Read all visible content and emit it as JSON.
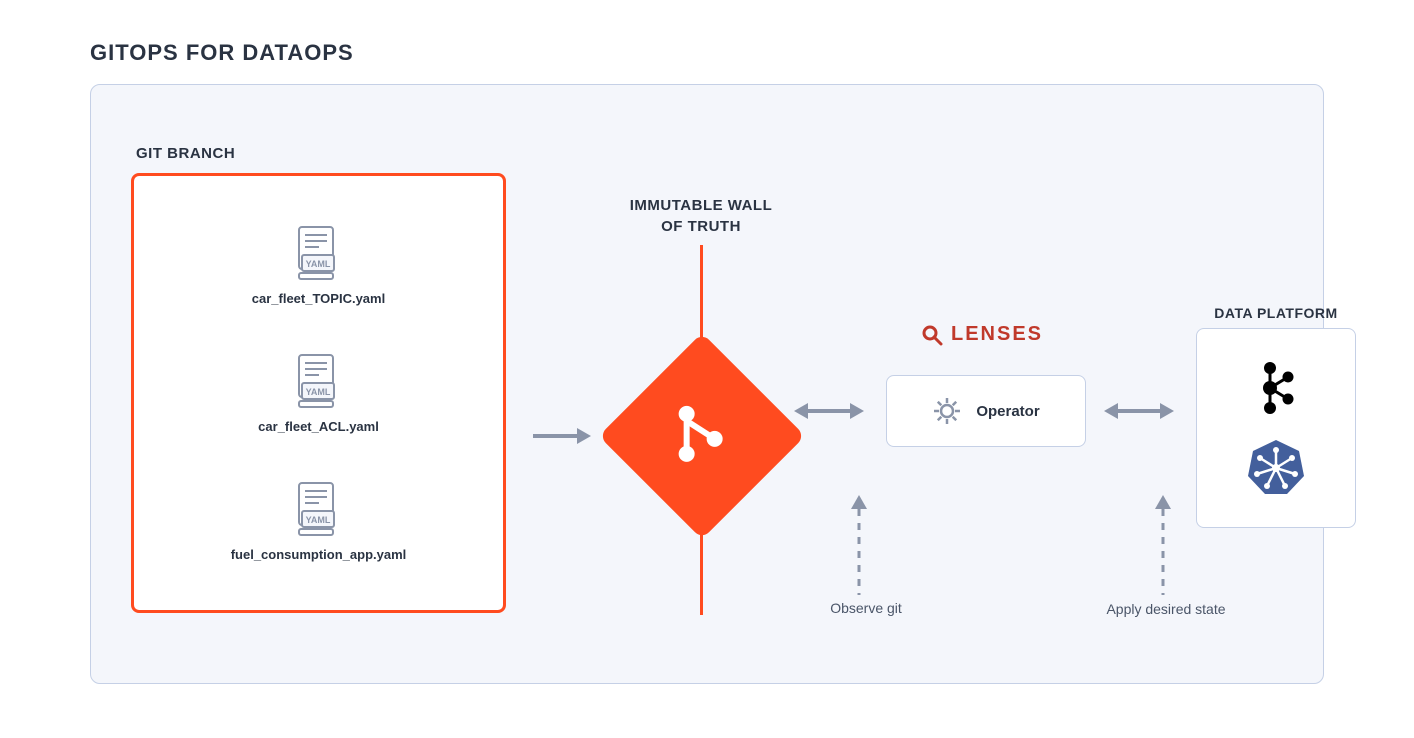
{
  "title": "GITOPS FOR DATAOPS",
  "git_branch": {
    "label": "GIT BRANCH",
    "files": [
      {
        "name": "car_fleet_TOPIC.yaml",
        "type": "YAML"
      },
      {
        "name": "car_fleet_ACL.yaml",
        "type": "YAML"
      },
      {
        "name": "fuel_consumption_app.yaml",
        "type": "YAML"
      }
    ]
  },
  "wall": {
    "label_line1": "IMMUTABLE WALL",
    "label_line2": "OF TRUTH"
  },
  "lenses": {
    "brand": "LENSES"
  },
  "operator": {
    "label": "Operator"
  },
  "data_platform": {
    "label": "DATA PLATFORM"
  },
  "annotations": {
    "observe": "Observe git",
    "apply": "Apply desired state"
  },
  "colors": {
    "accent": "#ff4b1f",
    "border": "#c5d0e6",
    "text": "#2a3342",
    "muted": "#8a94a8",
    "lenses": "#c0392b",
    "k8s": "#3b5998"
  }
}
